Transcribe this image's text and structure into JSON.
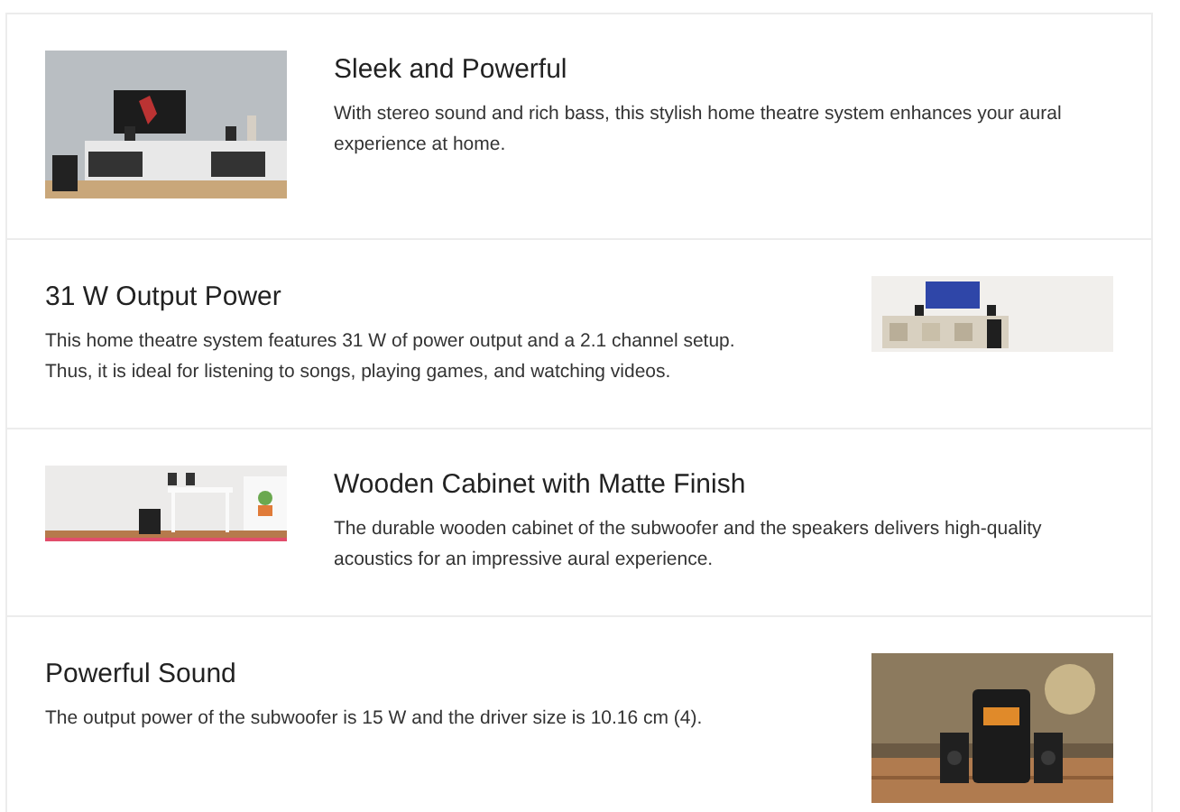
{
  "features": [
    {
      "kind": "image_left",
      "title": "Sleek and Powerful",
      "description": "With stereo sound and rich bass, this stylish home theatre system enhances your aural experience at home."
    },
    {
      "kind": "image_right",
      "title": "31 W Output Power",
      "description": "This home theatre system features 31 W of power output and a 2.1 channel setup. Thus, it is ideal for listening to songs, playing games, and watching videos."
    },
    {
      "kind": "image_left",
      "title": "Wooden Cabinet with Matte Finish",
      "description": "The durable wooden cabinet of the subwoofer and the speakers delivers high-quality acoustics for an impressive aural experience."
    },
    {
      "kind": "image_right",
      "title": "Powerful Sound",
      "description": "The output power of the subwoofer is 15 W and the driver size is 10.16 cm (4)."
    }
  ]
}
